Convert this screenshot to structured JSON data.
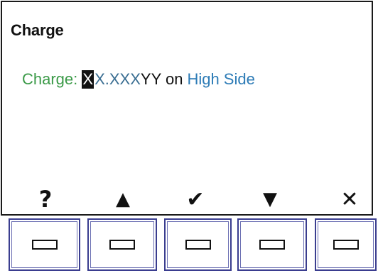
{
  "screen": {
    "title": "Charge",
    "charge_line": {
      "label": "Charge: ",
      "cursor_char": "X",
      "value": "X.XXX",
      "unit": "YY",
      "connector": " on",
      "side": "High Side"
    }
  },
  "softkeys": [
    {
      "icon": "help-icon",
      "glyph": "?"
    },
    {
      "icon": "arrow-up-icon",
      "glyph": "▲"
    },
    {
      "icon": "checkmark-icon",
      "glyph": "✔"
    },
    {
      "icon": "arrow-down-icon",
      "glyph": "▼"
    },
    {
      "icon": "close-icon",
      "glyph": "✕"
    }
  ],
  "colors": {
    "label": "#3b9a48",
    "value": "#3a6e92",
    "side": "#2c7bb6",
    "button_border": "#3a3d8f"
  }
}
